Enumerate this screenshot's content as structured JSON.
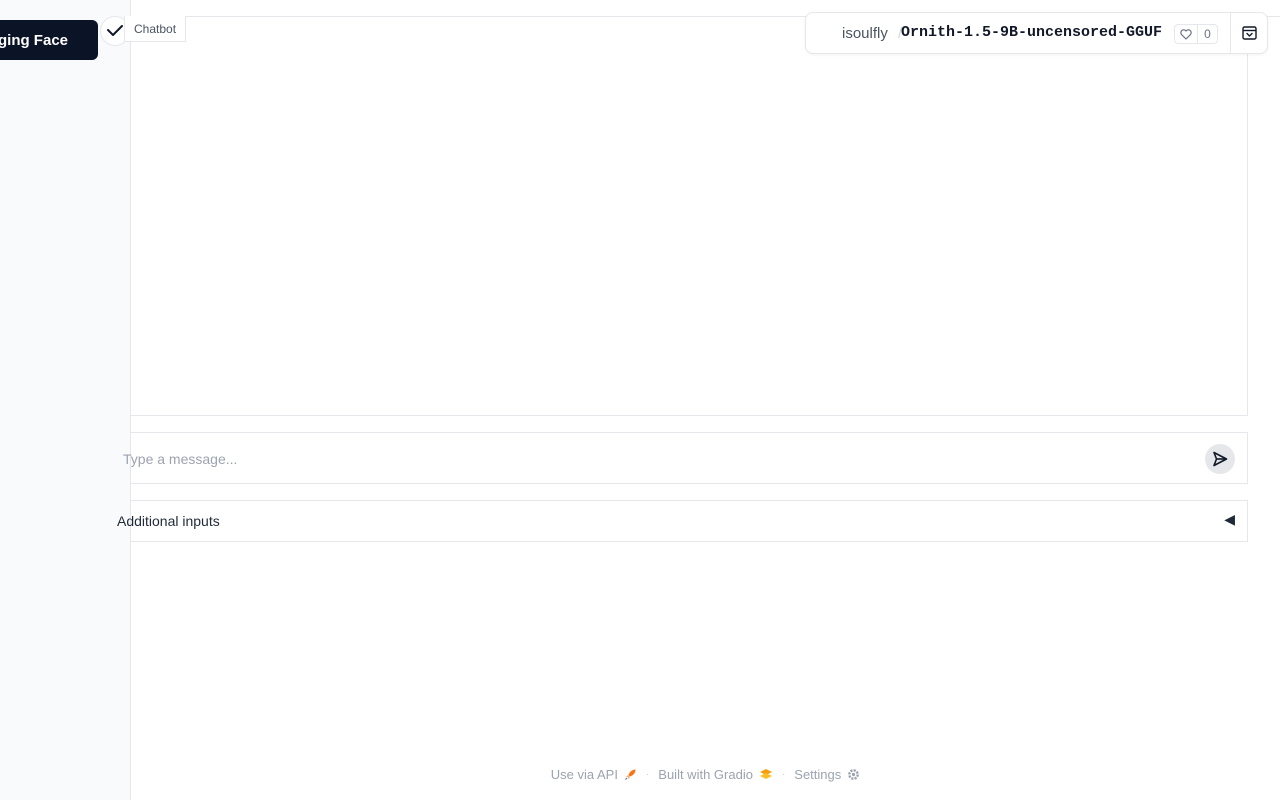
{
  "sidebar": {
    "badge_text": "Hugging Face",
    "collapse_icon": "chevron-check-icon"
  },
  "chatbot": {
    "label": "Chatbot"
  },
  "input": {
    "placeholder": "Type a message...",
    "value": "",
    "send_icon": "send-icon"
  },
  "accordion": {
    "label": "Additional inputs",
    "arrow": "◀"
  },
  "space": {
    "owner": "isoulfly",
    "separator": "/",
    "name": "Ornith-1.5-9B-uncensored-GGUF",
    "likes": "0"
  },
  "footer": {
    "api_label": "Use via API",
    "gradio_label": "Built with Gradio",
    "settings_label": "Settings",
    "separator": "·"
  },
  "colors": {
    "badge_bg": "#0b1326",
    "border": "#e5e7eb",
    "sidebar_bg": "#f9fafb",
    "muted_text": "#9ca3af"
  }
}
